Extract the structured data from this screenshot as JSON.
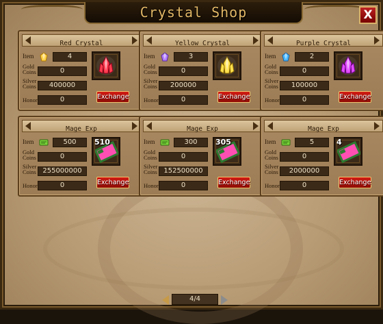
{
  "window": {
    "title": "Crystal Shop",
    "close_label": "X"
  },
  "labels": {
    "item": "Item",
    "gold_1": "Gold",
    "gold_2": "Coins",
    "silver_1": "Silver",
    "silver_2": "Coins",
    "honor": "Honor"
  },
  "cards": [
    {
      "title": "Red Crystal",
      "item_count": "4",
      "gold": "0",
      "silver": "400000",
      "honor": "0",
      "thumb_qty": "",
      "icon": "red-gem-icon",
      "thumb_icon": "red-crystal-icon",
      "exchange_label": "Exchange"
    },
    {
      "title": "Yellow Crystal",
      "item_count": "3",
      "gold": "0",
      "silver": "200000",
      "honor": "0",
      "thumb_qty": "",
      "icon": "purple-gem-icon",
      "thumb_icon": "yellow-crystal-icon",
      "exchange_label": "Exchange"
    },
    {
      "title": "Purple Crystal",
      "item_count": "2",
      "gold": "0",
      "silver": "100000",
      "honor": "0",
      "thumb_qty": "",
      "icon": "blue-gem-icon",
      "thumb_icon": "purple-crystal-icon",
      "exchange_label": "Exchange"
    },
    {
      "title": "Mage Exp",
      "item_count": "500",
      "gold": "0",
      "silver": "255000000",
      "honor": "0",
      "thumb_qty": "510",
      "icon": "green-scroll-icon",
      "thumb_icon": "mage-exp-card-icon",
      "thumb_card_text": "Mage",
      "thumb_card_num": "100",
      "exchange_label": "Exchange"
    },
    {
      "title": "Mage Exp",
      "item_count": "300",
      "gold": "0",
      "silver": "152500000",
      "honor": "0",
      "thumb_qty": "305",
      "icon": "green-scroll-icon",
      "thumb_icon": "mage-exp-card-icon",
      "thumb_card_text": "Mage",
      "thumb_card_num": "100",
      "exchange_label": "Exchange"
    },
    {
      "title": "Mage Exp",
      "item_count": "5",
      "gold": "0",
      "silver": "2000000",
      "honor": "0",
      "thumb_qty": "4",
      "icon": "green-scroll-icon",
      "thumb_icon": "mage-exp-card-icon",
      "thumb_card_text": "Mage",
      "thumb_card_num": "100",
      "exchange_label": "Exchange"
    }
  ],
  "pager": {
    "label": "4/4"
  },
  "colors": {
    "accent_red": "#d21b12",
    "title_gold": "#e3b866",
    "parchment": "#b79b74"
  }
}
